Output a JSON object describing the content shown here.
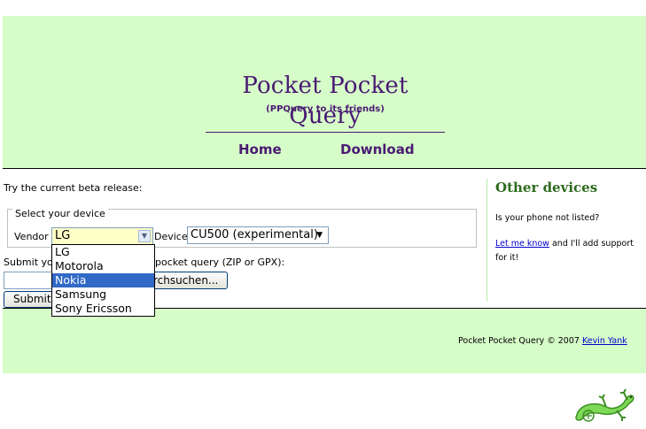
{
  "header": {
    "title": "Pocket Pocket Query",
    "subtitle": "(PPQuery to its friends)"
  },
  "nav": {
    "home": "Home",
    "download": "Download"
  },
  "main": {
    "intro": "Try the current beta release:",
    "fieldset_legend": "Select your device",
    "vendor_label": "Vendor",
    "vendor_value": "LG",
    "device_label": "Device",
    "device_value": "CU500 (experimental)",
    "vendor_options": [
      "LG",
      "Motorola",
      "Nokia",
      "Samsung",
      "Sony Ericsson"
    ],
    "highlighted_option": "Nokia",
    "submit_label_left": "Submit yo",
    "submit_label_right": "pocket query (ZIP or GPX):",
    "browse_button": "rchsuchen...",
    "submit_button": "Submit"
  },
  "sidebar": {
    "title": "Other devices",
    "question": "Is your phone not listed?",
    "link": "Let me know",
    "text_after_link": " and I'll add support",
    "text_line2": "for it!"
  },
  "footer": {
    "text": "Pocket Pocket Query © 2007 ",
    "author": "Kevin Yank"
  },
  "colors": {
    "page_background": "#d6fcc8",
    "title_color": "#4a1a73",
    "sidebar_title_color": "#2e6b1e",
    "selection_color": "#3169c6"
  },
  "icons": {
    "logo": "gecko-lizard-icon"
  }
}
